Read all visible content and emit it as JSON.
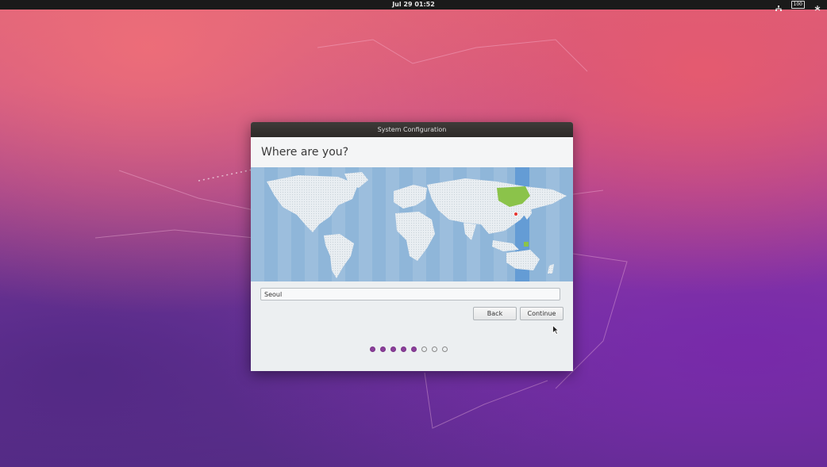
{
  "topbar": {
    "clock": "Jul 29  01:52",
    "battery": "100"
  },
  "window": {
    "title": "System Configuration",
    "heading": "Where are you?",
    "timezone_input": {
      "value": "Seoul"
    },
    "buttons": {
      "back": "Back",
      "continue": "Continue"
    },
    "progress": {
      "total_steps": 8,
      "completed_steps": 5
    }
  },
  "colors": {
    "accent": "#8a3f9a",
    "map_ocean": "#8fb6d9",
    "selected_zone": "#6fa8dc",
    "selected_region": "#8bc34a"
  },
  "icons": [
    "network-icon",
    "battery-icon",
    "power-icon",
    "mouse-cursor-icon"
  ]
}
